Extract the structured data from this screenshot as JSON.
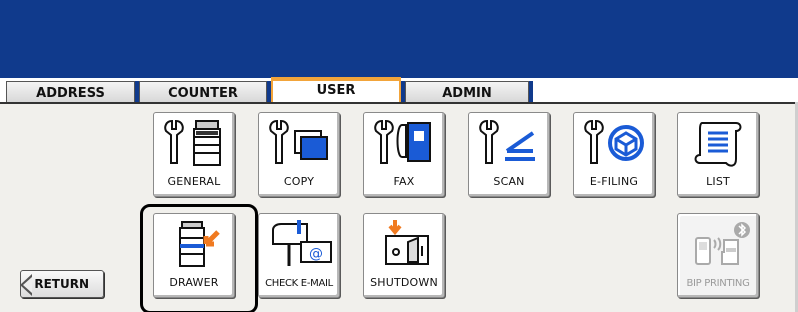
{
  "tabs": [
    {
      "label": "ADDRESS",
      "active": false
    },
    {
      "label": "COUNTER",
      "active": false
    },
    {
      "label": "USER",
      "active": true
    },
    {
      "label": "ADMIN",
      "active": false
    }
  ],
  "menu_row1": [
    {
      "label": "GENERAL",
      "icon": "wrench-copier-icon"
    },
    {
      "label": "COPY",
      "icon": "wrench-copy-icon"
    },
    {
      "label": "FAX",
      "icon": "wrench-fax-icon"
    },
    {
      "label": "SCAN",
      "icon": "wrench-scan-icon"
    },
    {
      "label": "E-FILING",
      "icon": "wrench-efiling-icon"
    },
    {
      "label": "LIST",
      "icon": "list-scroll-icon"
    }
  ],
  "menu_row2": [
    {
      "label": "DRAWER",
      "icon": "drawer-icon",
      "selected": true
    },
    {
      "label": "CHECK E-MAIL",
      "icon": "check-email-icon"
    },
    {
      "label": "SHUTDOWN",
      "icon": "shutdown-switch-icon"
    }
  ],
  "bip_printing": {
    "label": "BIP PRINTING",
    "icon": "bip-printing-icon",
    "enabled": false
  },
  "return_button": {
    "label": "RETURN"
  },
  "colors": {
    "header": "#103a8c",
    "active_tab_accent": "#f2a43a",
    "panel": "#f1f0ec"
  }
}
